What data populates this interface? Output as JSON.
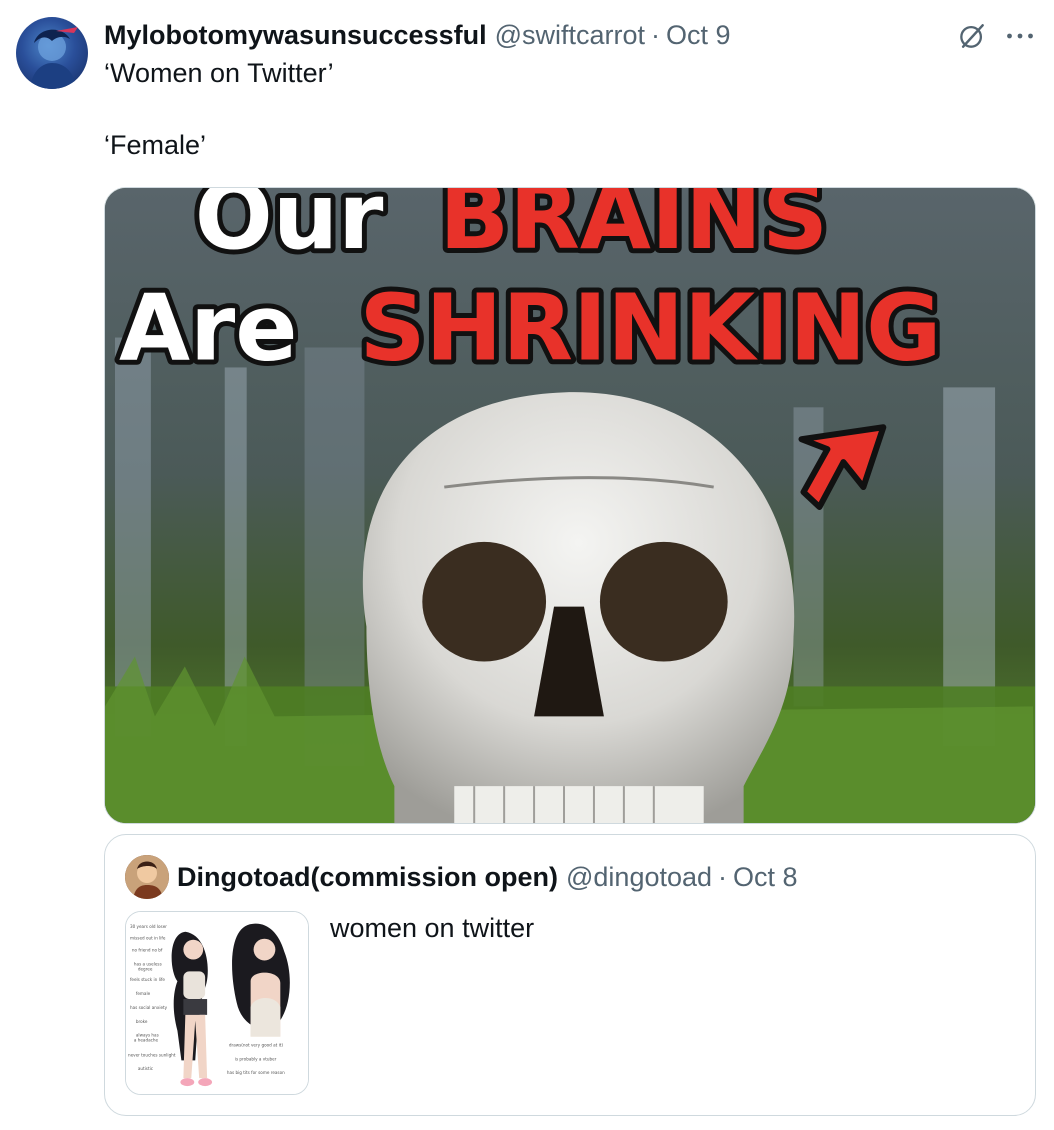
{
  "tweet": {
    "author": {
      "display_name": "Mylobotomywasunsuccessful",
      "handle": "@swiftcarrot",
      "avatar_icon": "user-avatar"
    },
    "separator": "·",
    "date": "Oct 9",
    "text_line1": "‘Women on Twitter’",
    "text_line2": "‘Female’",
    "media": {
      "headline_white_1": "Our",
      "headline_red_1": "BRAINS",
      "headline_white_2": "Are",
      "headline_red_2": "SHRINKING"
    },
    "icons": {
      "grok": "grok-icon",
      "more": "more-icon"
    }
  },
  "quote": {
    "author": {
      "display_name": "Dingotoad(commission open)",
      "handle": "@dingotoad"
    },
    "separator": "·",
    "date": "Oct 8",
    "text": "women on twitter",
    "thumbnail_labels_left": [
      "30 years old loser",
      "missed out in life",
      "no friend no bf",
      "has a useless",
      "degree",
      "feels stuck in life",
      "female",
      "has social anxiety",
      "broke",
      "always has",
      "a headache",
      "never touches sunlight",
      "autistic"
    ],
    "thumbnail_labels_right": [
      "draws(not very good at it)",
      "is probably a vtuber",
      "has big tits for some reason"
    ]
  },
  "colors": {
    "text_primary": "#0f1419",
    "text_secondary": "#536471",
    "border": "#cfd9de",
    "headline_red": "#e8322a"
  }
}
